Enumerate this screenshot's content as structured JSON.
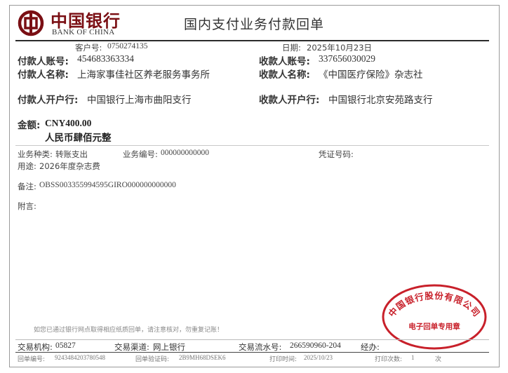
{
  "bank": {
    "name_cn": "中国银行",
    "name_en": "BANK OF CHINA",
    "brand_color": "#7a0f14"
  },
  "title": "国内支付业务付款回单",
  "header": {
    "customer_no_label": "客户号:",
    "customer_no": "0750274135",
    "date_label": "日期:",
    "date": "2025年10月23日"
  },
  "payer": {
    "account_label": "付款人账号:",
    "account": "454683363334",
    "name_label": "付款人名称:",
    "name": "上海家事佳社区养老服务事务所",
    "bank_label": "付款人开户行:",
    "bank": "中国银行上海市曲阳支行"
  },
  "payee": {
    "account_label": "收款人账号:",
    "account": "337656030029",
    "name_label": "收款人名称:",
    "name": "《中国医疗保险》杂志社",
    "bank_label": "收款人开户行:",
    "bank": "中国银行北京安苑路支行"
  },
  "amount": {
    "label": "金额:",
    "value": "CNY400.00",
    "in_words": "人民币肆佰元整"
  },
  "business": {
    "type_label": "业务种类:",
    "type": "转账支出",
    "number_label": "业务编号:",
    "number": "000000000000",
    "voucher_label": "凭证号码:",
    "voucher": "",
    "purpose_label": "用途:",
    "purpose": "2026年度杂志费",
    "remark_label": "备注:",
    "remark": "OBSS003355994595GIRO000000000000",
    "note_label": "附言:",
    "note": ""
  },
  "notice": "如您已通过银行网点取得相应纸质回单，请注意核对，勿重复记账！",
  "seal": {
    "org": "中国银行股份有限公司",
    "purpose": "电子回单专用章",
    "color": "#c8202a"
  },
  "footer": {
    "org_label": "交易机构:",
    "org": "05827",
    "channel_label": "交易渠道:",
    "channel": "网上银行",
    "serial_label": "交易流水号:",
    "serial": "266590960-204",
    "handler_label": "经办:",
    "handler": "",
    "receipt_no_label": "回单编号:",
    "receipt_no": "9243484203780548",
    "verify_label": "回单验证码:",
    "verify": "2B9MH68DSEK6",
    "print_time_label": "打印时间:",
    "print_time": "2025/10/23",
    "print_count_label": "打印次数:",
    "print_count": "1",
    "print_count_unit": "次"
  }
}
